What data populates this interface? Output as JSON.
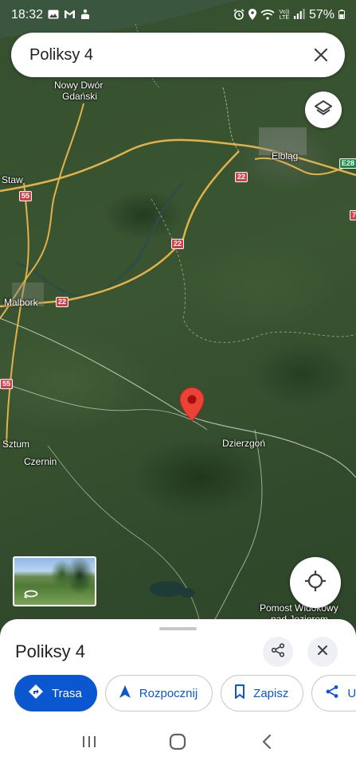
{
  "status_bar": {
    "time": "18:32",
    "network": "Vo))\nLTE",
    "battery": "57%"
  },
  "search": {
    "query": "Poliksy 4"
  },
  "map": {
    "places": {
      "nowy_dwor_1": "Nowy Dwór",
      "nowy_dwor_2": "Gdański",
      "elblag": "Elbląg",
      "staw": "Staw",
      "malbork": "Malbork",
      "sztum": "Sztum",
      "czernin": "Czernin",
      "dzierzgon": "Dzierzgoń",
      "pomost_1": "Pomost Widokowy",
      "pomost_2": "nad Jeziorem"
    },
    "roads": {
      "r22_a": "22",
      "r22_b": "22",
      "r22_c": "22",
      "r55_a": "55",
      "r55_b": "55",
      "e28": "E28",
      "r7": "7"
    }
  },
  "sheet": {
    "title": "Poliksy 4",
    "actions": {
      "directions": "Trasa",
      "start": "Rozpocznij",
      "save": "Zapisz",
      "share": "U"
    }
  },
  "colors": {
    "accent": "#0b57d0",
    "pin": "#ea4335"
  }
}
